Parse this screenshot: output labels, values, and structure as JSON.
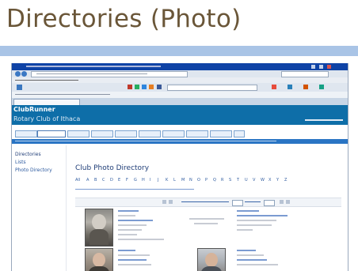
{
  "slide": {
    "title": "Directories (Photo)"
  },
  "browser": {
    "colors": {
      "titlebar": "#0f43a6",
      "menubar": "#e9edf3",
      "toolbar": "#dfe6ef",
      "page_header": "#0e6ea8"
    }
  },
  "site": {
    "brand": "ClubRunner",
    "club_name": "Rotary Club of Ithaca",
    "sidebar_items": [
      "Directories",
      "Lists",
      "Photo Directory"
    ],
    "directory_title": "Club Photo Directory",
    "alphabet": [
      "All",
      "A",
      "B",
      "C",
      "D",
      "E",
      "F",
      "G",
      "H",
      "I",
      "J",
      "K",
      "L",
      "M",
      "N",
      "O",
      "P",
      "Q",
      "R",
      "S",
      "T",
      "U",
      "V",
      "W",
      "X",
      "Y",
      "Z"
    ]
  }
}
